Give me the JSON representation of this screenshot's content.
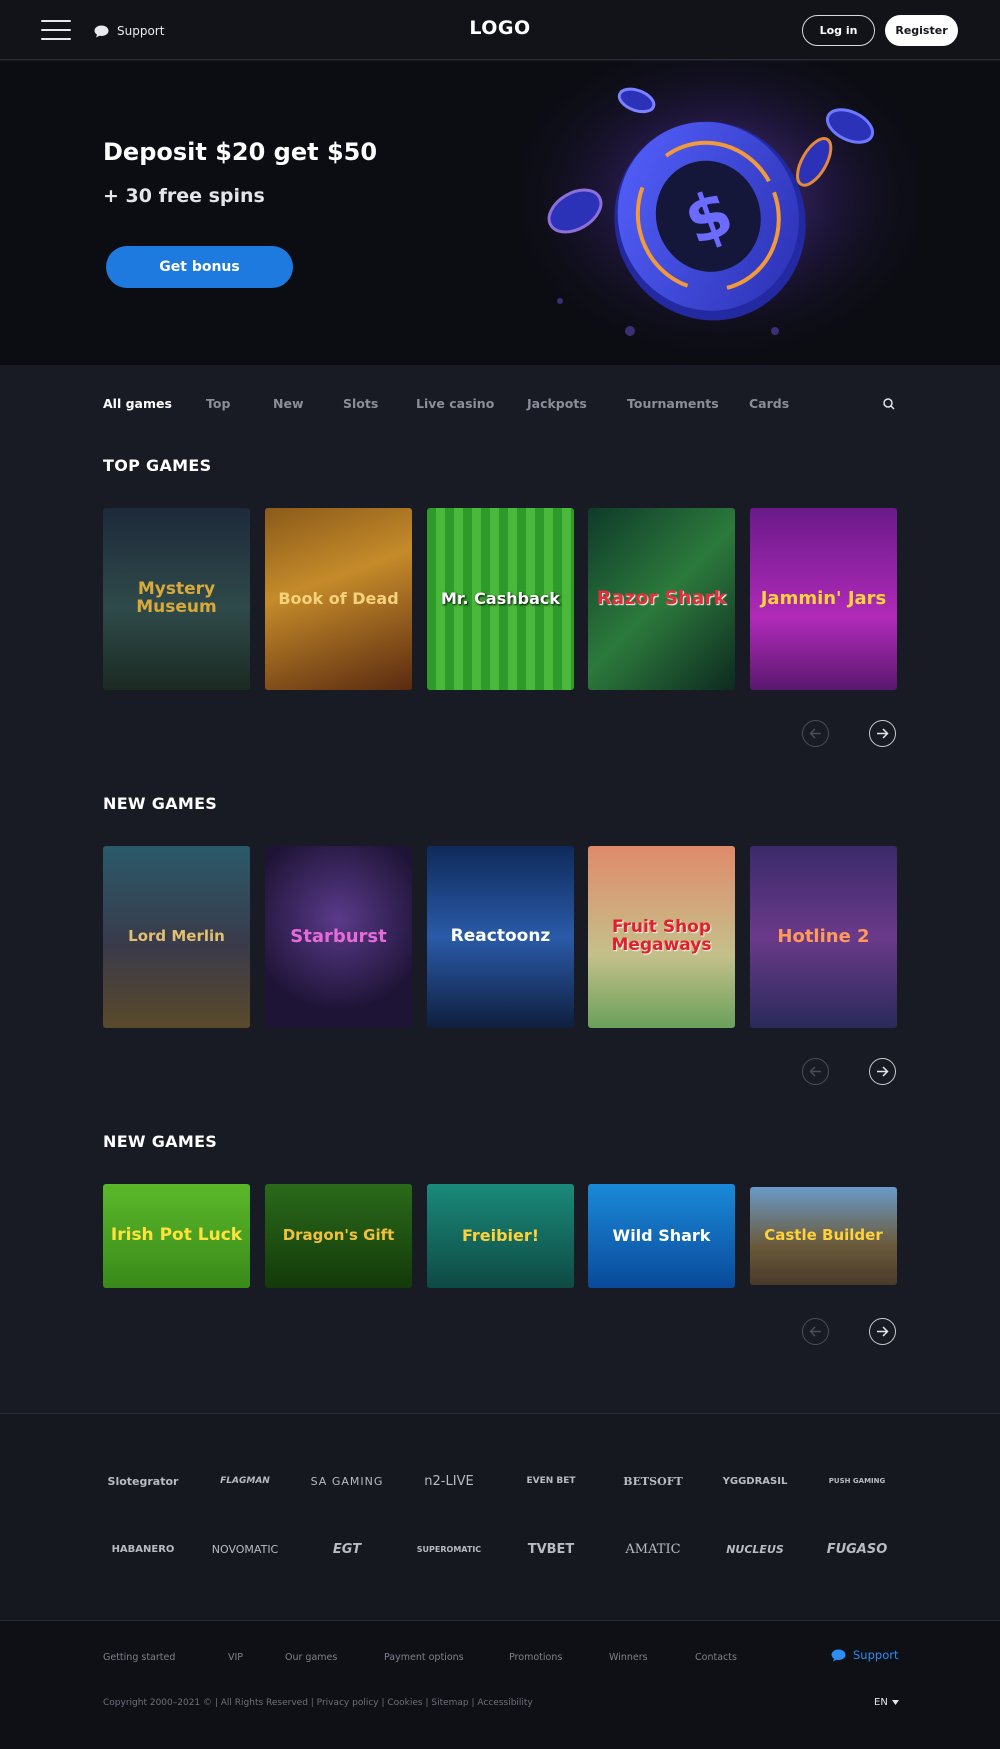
{
  "header": {
    "support_label": "Support",
    "logo": "LOGO",
    "login_label": "Log in",
    "register_label": "Register"
  },
  "hero": {
    "title": "Deposit $20 get $50",
    "subtitle": "+ 30 free spins",
    "cta_label": "Get bonus"
  },
  "tabs": [
    "All games",
    "Top",
    "New",
    "Slots",
    "Live casino",
    "Jackpots",
    "Tournaments",
    "Cards"
  ],
  "sections": [
    {
      "title": "TOP GAMES",
      "games": [
        "Mystery Museum",
        "Book of Dead",
        "Mr. Cashback",
        "Razor Shark",
        "Jammin' Jars"
      ]
    },
    {
      "title": "NEW GAMES",
      "games": [
        "Lord Merlin",
        "Starburst",
        "Reactoonz",
        "Fruit Shop Megaways",
        "Hotline 2"
      ]
    },
    {
      "title": "NEW GAMES",
      "games": [
        "Irish Pot Luck",
        "Dragon's Gift",
        "Freibier!",
        "Wild Shark",
        "Castle Builder"
      ]
    }
  ],
  "providers": [
    "Slotegrator",
    "FLAGMAN",
    "SA GAMING",
    "n2-LIVE",
    "EVEN BET",
    "BETSOFT",
    "YGGDRASIL",
    "PUSH GAMING",
    "HABANERO",
    "NOVOMATIC",
    "EGT",
    "SUPEROMATIC",
    "TVBET",
    "AMATIC",
    "NUCLEUS",
    "FUGASO"
  ],
  "footer": {
    "links": [
      "Getting started",
      "VIP",
      "Our games",
      "Payment options",
      "Promotions",
      "Winners",
      "Contacts"
    ],
    "support_label": "Support",
    "copyright": "Copyright 2000–2021 © | All Rights Reserved | Privacy policy | Cookies | Sitemap | Accessibility",
    "language": "EN"
  },
  "colors": {
    "accent_blue": "#1f7ae0",
    "background": "#191b24",
    "header_bg": "#121319"
  }
}
